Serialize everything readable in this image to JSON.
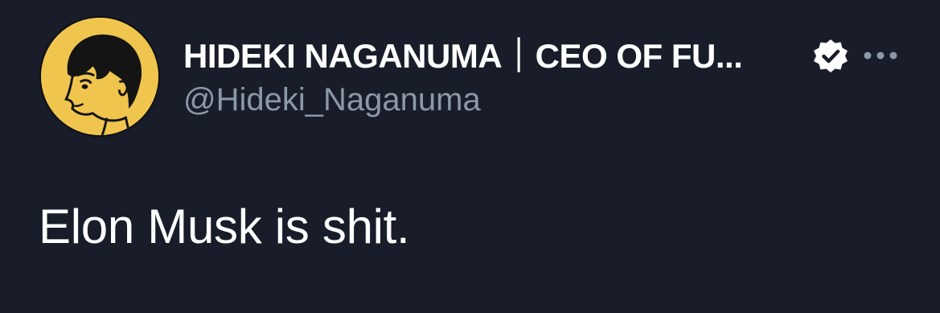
{
  "tweet": {
    "author": {
      "display_name": "HIDEKI NAGANUMA｜CEO OF FU...",
      "handle": "@Hideki_Naganuma",
      "verified": true,
      "verified_icon": "verified-badge-icon",
      "avatar_icon": "cartoon-portrait-avatar"
    },
    "more_icon": "more-horizontal-icon",
    "text": "Elon Musk is shit."
  },
  "colors": {
    "background": "#181d29",
    "primary_text": "#ffffff",
    "secondary_text": "#8b98a5",
    "avatar_background": "#f0c54e",
    "more_icon": "#8b98a5"
  }
}
